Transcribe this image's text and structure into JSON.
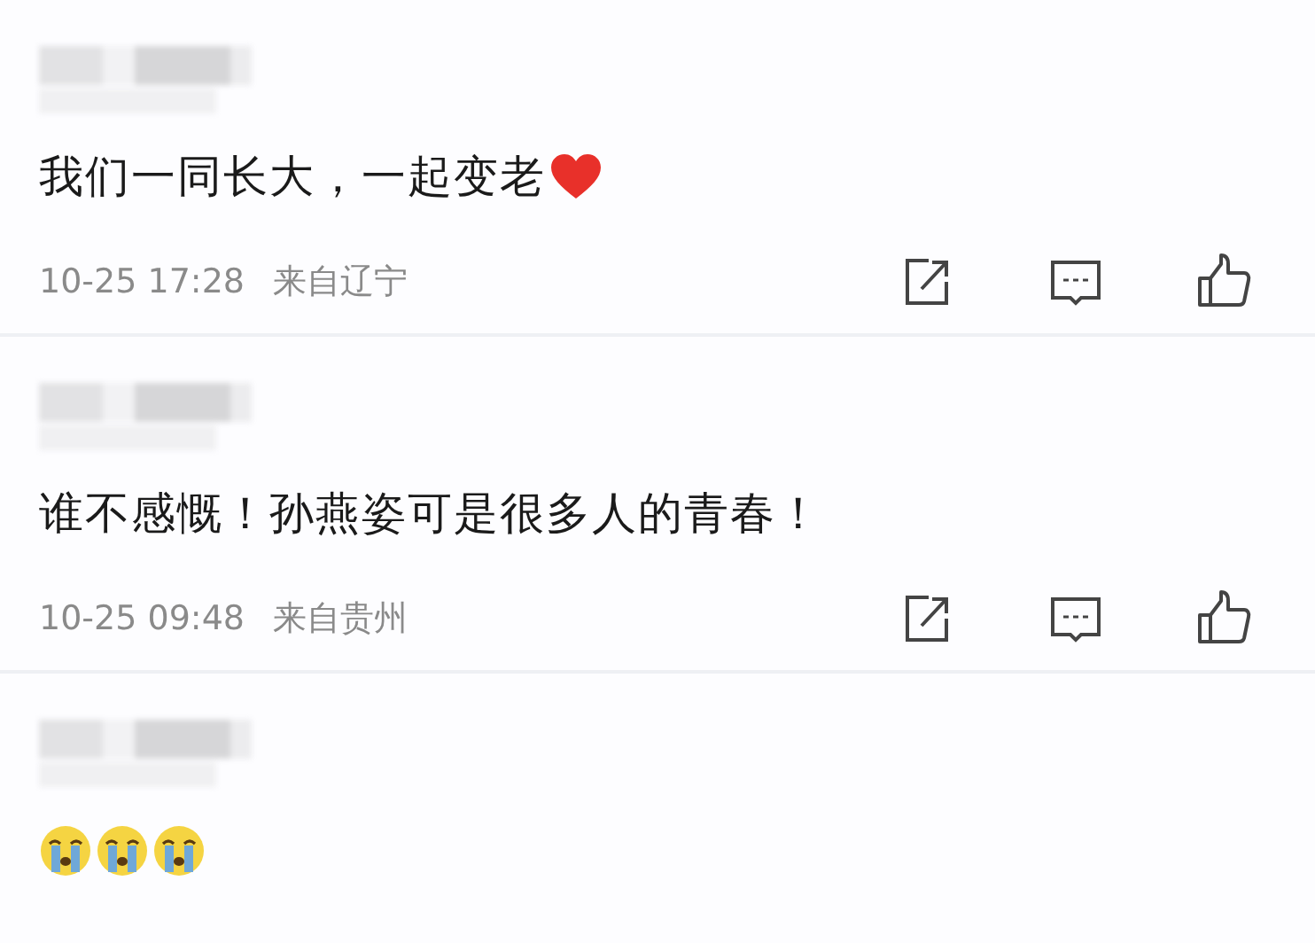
{
  "comments": [
    {
      "text": "我们一同长大，一起变老",
      "emoji": [
        {
          "kind": "heart"
        }
      ],
      "time": "10-25 17:28",
      "location": "来自辽宁"
    },
    {
      "text": "谁不感慨！孙燕姿可是很多人的青春！",
      "time": "10-25 09:48",
      "location": "来自贵州"
    },
    {
      "emoji": [
        {
          "kind": "crying"
        },
        {
          "kind": "crying"
        },
        {
          "kind": "crying"
        }
      ]
    }
  ]
}
